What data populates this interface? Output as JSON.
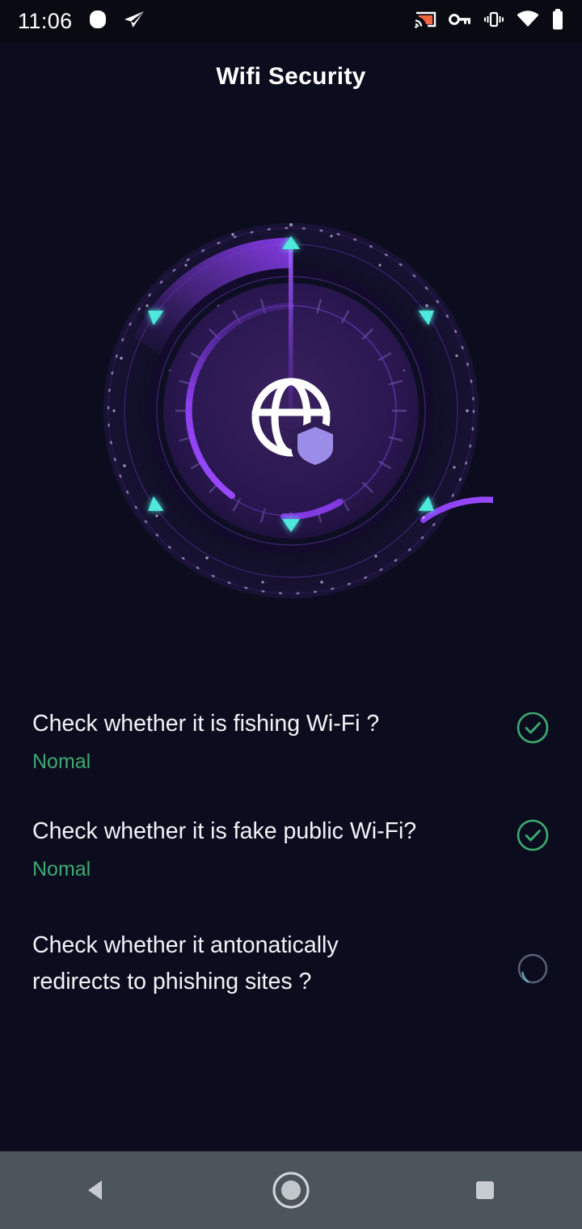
{
  "status_bar": {
    "time": "11:06",
    "left_icons": [
      {
        "name": "rounded-square-icon",
        "label": "notification"
      },
      {
        "name": "paper-plane-icon",
        "label": "telegram"
      }
    ],
    "right_icons": [
      {
        "name": "cast-icon",
        "label": "cast",
        "color": "#f0653f"
      },
      {
        "name": "vpn-key-icon",
        "label": "vpn"
      },
      {
        "name": "vibrate-icon",
        "label": "vibrate"
      },
      {
        "name": "wifi-icon",
        "label": "wifi"
      },
      {
        "name": "battery-icon",
        "label": "battery"
      }
    ]
  },
  "header": {
    "title": "Wifi Security"
  },
  "scanner": {
    "center_icon": "globe-shield-icon",
    "sweep_angle_deg": 0,
    "progress_arc_deg": 190,
    "colors": {
      "accent_purple": "#8b3df0",
      "arc_light": "#7b40d4",
      "marker_cyan": "#4fe8dc",
      "ring_outline": "#3a2560",
      "dial_fill": "#2d1b52"
    }
  },
  "checks": {
    "items": [
      {
        "title": "Check whether it is fishing Wi-Fi ?",
        "status": "Nomal",
        "state": "done",
        "icon": "check-circle-icon"
      },
      {
        "title": "Check whether it is fake public Wi-Fi?",
        "status": "Nomal",
        "state": "done",
        "icon": "check-circle-icon"
      },
      {
        "title": "Check whether it antonatically redirects to phishing sites ?",
        "title_line_1": "Check whether it antonatically",
        "title_line_2": "redirects to phishing sites ?",
        "status": "",
        "state": "pending",
        "icon": "pending-circle-icon"
      }
    ],
    "colors": {
      "done": "#3dab70",
      "pending": "#5a6175"
    }
  },
  "nav_bar": {
    "buttons": [
      {
        "name": "back-button",
        "label": "Back"
      },
      {
        "name": "home-button",
        "label": "Home"
      },
      {
        "name": "recents-button",
        "label": "Recents"
      }
    ]
  }
}
